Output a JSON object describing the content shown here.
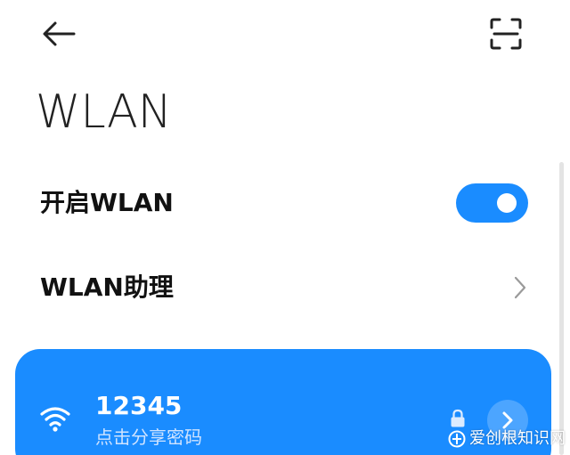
{
  "header": {
    "back_icon": "arrow-left-icon",
    "scan_icon": "scan-frame-icon",
    "title": "WLAN"
  },
  "settings": {
    "wlan_toggle": {
      "label": "开启WLAN",
      "enabled": true
    },
    "wlan_assistant": {
      "label": "WLAN助理",
      "icon": "chevron-right-icon"
    }
  },
  "connected_network": {
    "name": "12345",
    "subtitle": "点击分享密码",
    "wifi_icon": "wifi-icon",
    "lock_icon": "lock-icon",
    "detail_icon": "chevron-right-icon"
  },
  "watermark": {
    "text": "爱创根知识网"
  },
  "colors": {
    "accent": "#1a8cff",
    "card": "#1a8cff",
    "text": "#111111",
    "white": "#ffffff"
  }
}
